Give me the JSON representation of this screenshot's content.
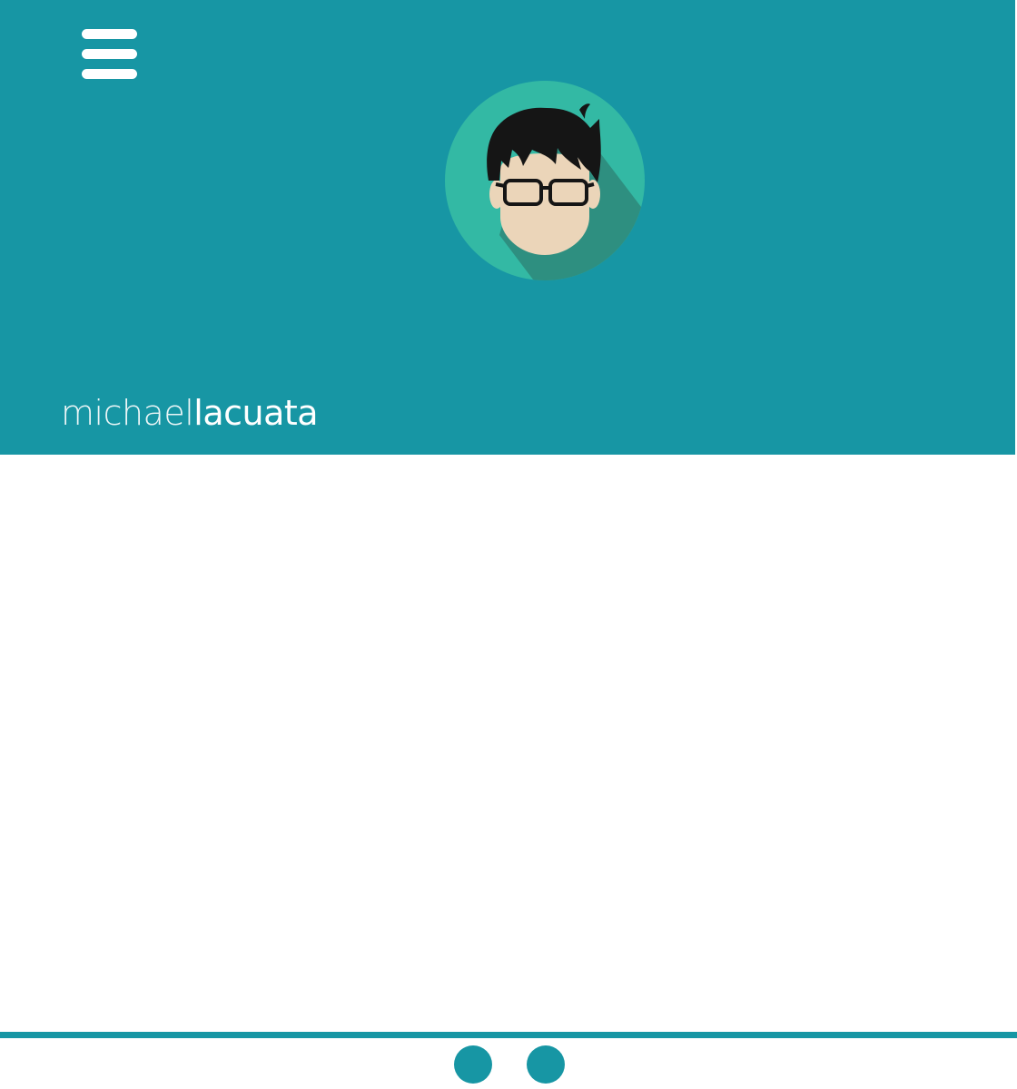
{
  "header": {
    "menu_icon": "hamburger-menu-icon",
    "avatar_icon": "avatar-illustration-icon",
    "brand": {
      "first": "michael",
      "last": "lacuata"
    }
  },
  "footer": {
    "pagination_dots": 2
  },
  "colors": {
    "accent": "#1796a4",
    "avatar_circle": "#33b9a4",
    "avatar_shadow": "#2e8f80",
    "skin": "#ebd5b9",
    "hair": "#151515",
    "background": "#ffffff"
  }
}
